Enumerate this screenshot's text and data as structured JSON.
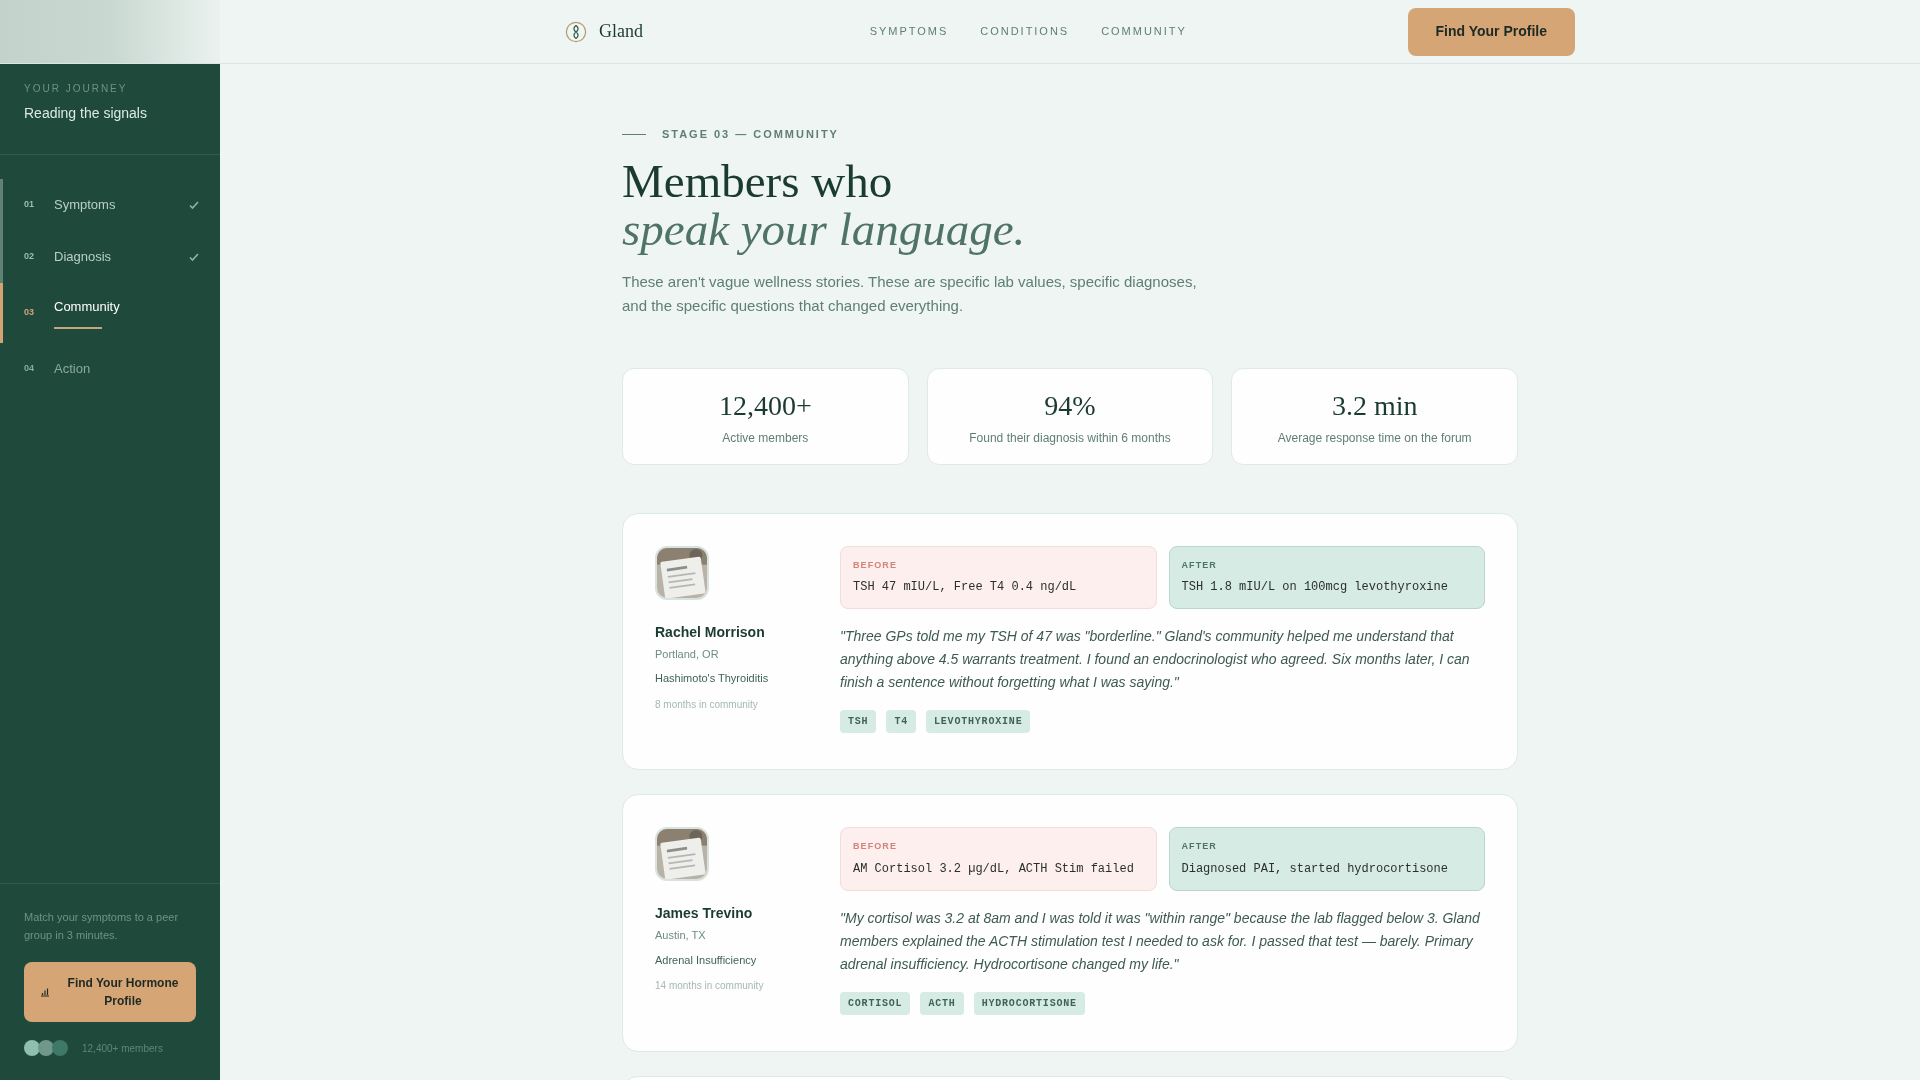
{
  "header": {
    "brand": "Gland",
    "nav": [
      "SYMPTOMS",
      "CONDITIONS",
      "COMMUNITY"
    ],
    "cta": "Find Your Profile"
  },
  "sidebar": {
    "eyebrow": "YOUR JOURNEY",
    "title": "Reading the signals",
    "steps": [
      {
        "number": "01",
        "label": "Symptoms",
        "done": true,
        "selected": false
      },
      {
        "number": "02",
        "label": "Diagnosis",
        "done": true,
        "selected": false
      },
      {
        "number": "03",
        "label": "Community",
        "done": false,
        "selected": true
      },
      {
        "number": "04",
        "label": "Action",
        "done": false,
        "selected": false
      }
    ],
    "promo": "Match your symptoms to a peer group in 3 minutes.",
    "cta": "Find Your Hormone Profile",
    "members": "12,400+ members"
  },
  "intro": {
    "eyebrow": "STAGE 03 — COMMUNITY",
    "title": "Members who",
    "title_italic": "speak your language.",
    "lead": "These aren't vague wellness stories. These are specific lab values, specific diagnoses, and the specific questions that changed everything."
  },
  "stats": [
    {
      "value": "12,400+",
      "label": "Active members"
    },
    {
      "value": "94%",
      "label": "Found their diagnosis within 6 months"
    },
    {
      "value": "3.2 min",
      "label": "Average response time on the forum"
    }
  ],
  "testimonials": [
    {
      "name": "Rachel Morrison",
      "location": "Portland, OR",
      "condition": "Hashimoto's Thyroiditis",
      "tenure": "8 months in community",
      "before_label": "BEFORE",
      "before": "TSH 47 mIU/L, Free T4 0.4 ng/dL",
      "after_label": "AFTER",
      "after": "TSH 1.8 mIU/L on 100mcg levothyroxine",
      "quote": "\"Three GPs told me my TSH of 47 was \"borderline.\" Gland's community helped me understand that anything above 4.5 warrants treatment. I found an endocrinologist who agreed. Six months later, I can finish a sentence without forgetting what I was saying.\"",
      "tags": [
        "TSH",
        "T4",
        "LEVOTHYROXINE"
      ]
    },
    {
      "name": "James Trevino",
      "location": "Austin, TX",
      "condition": "Adrenal Insufficiency",
      "tenure": "14 months in community",
      "before_label": "BEFORE",
      "before": "AM Cortisol 3.2 µg/dL, ACTH Stim failed",
      "after_label": "AFTER",
      "after": "Diagnosed PAI, started hydrocortisone",
      "quote": "\"My cortisol was 3.2 at 8am and I was told it was \"within range\" because the lab flagged below 3. Gland members explained the ACTH stimulation test I needed to ask for. I passed that test — barely. Primary adrenal insufficiency. Hydrocortisone changed my life.\"",
      "tags": [
        "CORTISOL",
        "ACTH",
        "HYDROCORTISONE"
      ]
    }
  ]
}
